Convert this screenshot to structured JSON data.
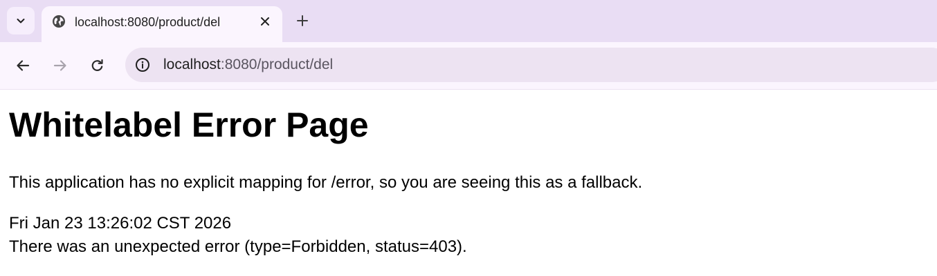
{
  "browser": {
    "tab": {
      "title": "localhost:8080/product/del"
    },
    "address_bar": {
      "host": "localhost",
      "rest": ":8080/product/del"
    },
    "icons": {
      "tab_search": "chevron-down-icon",
      "favicon": "globe-icon",
      "tab_close": "close-icon",
      "new_tab": "plus-icon",
      "back": "arrow-left-icon",
      "forward": "arrow-right-icon",
      "reload": "reload-icon",
      "site_info": "info-icon"
    },
    "colors": {
      "tab_strip": "#e9ddf4",
      "toolbar": "#fbf5fe",
      "omnibox": "#ede3f2"
    }
  },
  "page": {
    "heading": "Whitelabel Error Page",
    "message": "This application has no explicit mapping for /error, so you are seeing this as a fallback.",
    "timestamp": "Fri Jan 23 13:26:02 CST 2026",
    "error": "There was an unexpected error (type=Forbidden, status=403)."
  }
}
